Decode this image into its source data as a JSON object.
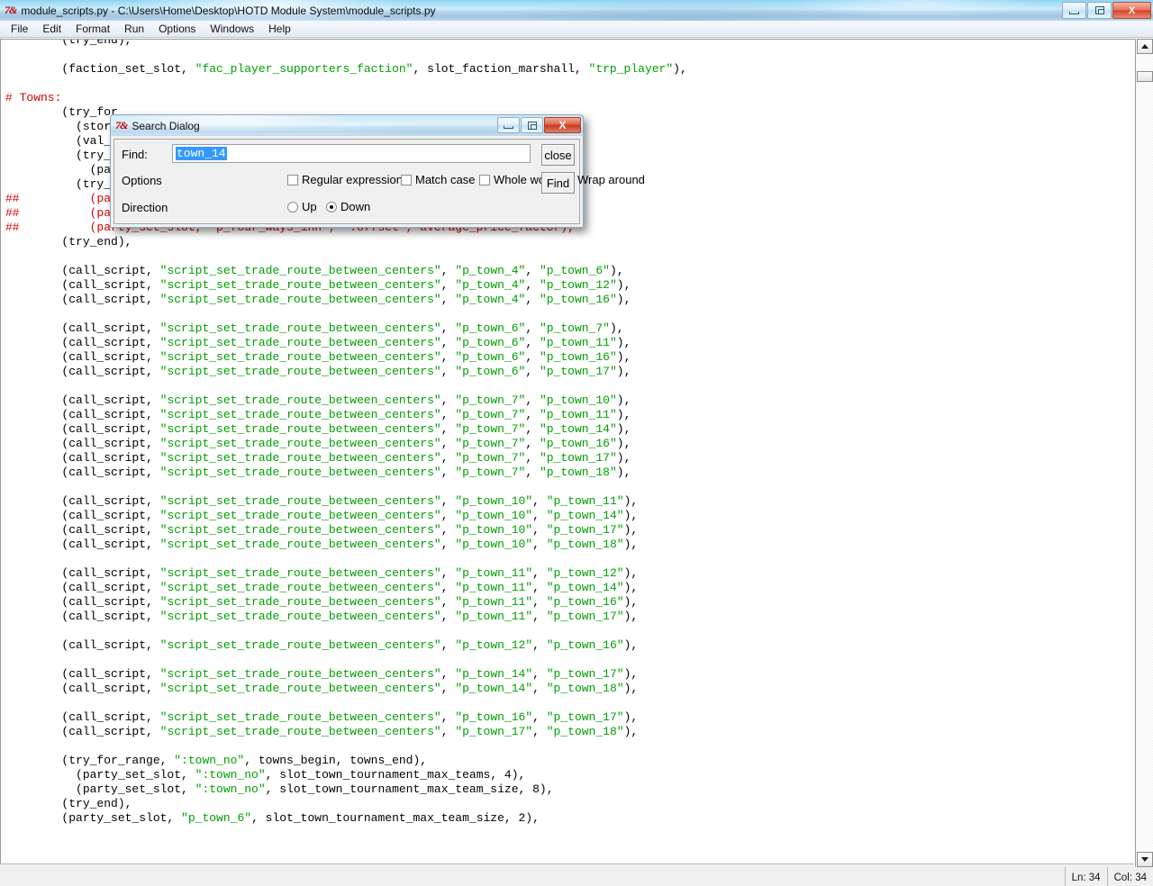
{
  "window": {
    "app_icon": "python-idle-icon",
    "title": "module_scripts.py - C:\\Users\\Home\\Desktop\\HOTD Module System\\module_scripts.py",
    "caption": {
      "minimize_label": "minimize-icon",
      "maximize_label": "maximize-icon",
      "close_label": "X"
    }
  },
  "menu": {
    "items": [
      {
        "label": "File"
      },
      {
        "label": "Edit"
      },
      {
        "label": "Format"
      },
      {
        "label": "Run"
      },
      {
        "label": "Options"
      },
      {
        "label": "Windows"
      },
      {
        "label": "Help"
      }
    ]
  },
  "editor": {
    "code": "        (try_end),\n\n        (faction_set_slot, \"fac_player_supporters_faction\", slot_faction_marshall, \"trp_player\"),\n\n# Towns:\n        (try_for\n          (store\n          (val_ad\n          (try_fo\n            (part\n          (try_en\n##          (part\n##          (party_set_slot, \"p_salt_mine\", \":offset\", average_price_factor),\n##          (party_set_slot, \"p_four_ways_inn\", \":offset\", average_price_factor),\n        (try_end),\n\n        (call_script, \"script_set_trade_route_between_centers\", \"p_town_4\", \"p_town_6\"),\n        (call_script, \"script_set_trade_route_between_centers\", \"p_town_4\", \"p_town_12\"),\n        (call_script, \"script_set_trade_route_between_centers\", \"p_town_4\", \"p_town_16\"),\n\n        (call_script, \"script_set_trade_route_between_centers\", \"p_town_6\", \"p_town_7\"),\n        (call_script, \"script_set_trade_route_between_centers\", \"p_town_6\", \"p_town_11\"),\n        (call_script, \"script_set_trade_route_between_centers\", \"p_town_6\", \"p_town_16\"),\n        (call_script, \"script_set_trade_route_between_centers\", \"p_town_6\", \"p_town_17\"),\n\n        (call_script, \"script_set_trade_route_between_centers\", \"p_town_7\", \"p_town_10\"),\n        (call_script, \"script_set_trade_route_between_centers\", \"p_town_7\", \"p_town_11\"),\n        (call_script, \"script_set_trade_route_between_centers\", \"p_town_7\", \"p_town_14\"),\n        (call_script, \"script_set_trade_route_between_centers\", \"p_town_7\", \"p_town_16\"),\n        (call_script, \"script_set_trade_route_between_centers\", \"p_town_7\", \"p_town_17\"),\n        (call_script, \"script_set_trade_route_between_centers\", \"p_town_7\", \"p_town_18\"),\n\n        (call_script, \"script_set_trade_route_between_centers\", \"p_town_10\", \"p_town_11\"),\n        (call_script, \"script_set_trade_route_between_centers\", \"p_town_10\", \"p_town_14\"),\n        (call_script, \"script_set_trade_route_between_centers\", \"p_town_10\", \"p_town_17\"),\n        (call_script, \"script_set_trade_route_between_centers\", \"p_town_10\", \"p_town_18\"),\n\n        (call_script, \"script_set_trade_route_between_centers\", \"p_town_11\", \"p_town_12\"),\n        (call_script, \"script_set_trade_route_between_centers\", \"p_town_11\", \"p_town_14\"),\n        (call_script, \"script_set_trade_route_between_centers\", \"p_town_11\", \"p_town_16\"),\n        (call_script, \"script_set_trade_route_between_centers\", \"p_town_11\", \"p_town_17\"),\n\n        (call_script, \"script_set_trade_route_between_centers\", \"p_town_12\", \"p_town_16\"),\n\n        (call_script, \"script_set_trade_route_between_centers\", \"p_town_14\", \"p_town_17\"),\n        (call_script, \"script_set_trade_route_between_centers\", \"p_town_14\", \"p_town_18\"),\n\n        (call_script, \"script_set_trade_route_between_centers\", \"p_town_16\", \"p_town_17\"),\n        (call_script, \"script_set_trade_route_between_centers\", \"p_town_17\", \"p_town_18\"),\n\n        (try_for_range, \":town_no\", towns_begin, towns_end),\n          (party_set_slot, \":town_no\", slot_town_tournament_max_teams, 4),\n          (party_set_slot, \":town_no\", slot_town_tournament_max_team_size, 8),\n        (try_end),\n        (party_set_slot, \"p_town_6\", slot_town_tournament_max_team_size, 2),"
  },
  "scrollbar": {
    "up_arrow": "scroll-up-icon",
    "down_arrow": "scroll-down-icon"
  },
  "status": {
    "line": "Ln: 34",
    "column": "Col: 34"
  },
  "dialog": {
    "icon": "python-idle-icon",
    "title": "Search Dialog",
    "caption": {
      "minimize_label": "minimize-icon",
      "maximize_label": "maximize-icon",
      "close_label": "X"
    },
    "find_label": "Find:",
    "find_value": "town_14",
    "options_label": "Options",
    "options": [
      {
        "label": "Regular expression",
        "checked": false
      },
      {
        "label": "Match case",
        "checked": false
      },
      {
        "label": "Whole word",
        "checked": false
      },
      {
        "label": "Wrap around",
        "checked": true
      }
    ],
    "direction_label": "Direction",
    "directions": [
      {
        "label": "Up",
        "selected": false
      },
      {
        "label": "Down",
        "selected": true
      }
    ],
    "close_label": "close",
    "find_button_label": "Find"
  },
  "colors": {
    "string_token": "#00a000",
    "comment_token": "#dd0000",
    "selection": "#3399ff",
    "title_bar": "#a9e0f7"
  }
}
